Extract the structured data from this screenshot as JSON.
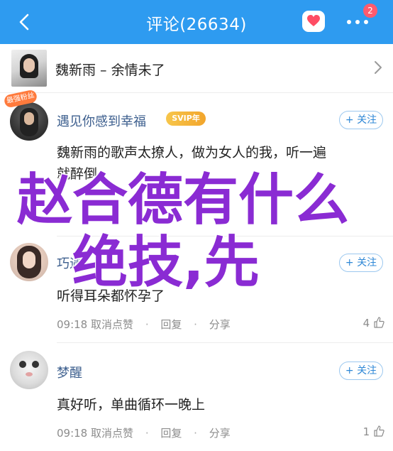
{
  "header": {
    "title": "评论(26634)",
    "badge_count": "2",
    "colors": {
      "bar": "#2e9bf0"
    },
    "icons": [
      "back-arrow-icon",
      "heart-icon",
      "more-icon"
    ]
  },
  "song": {
    "title": "魏新雨 – 余情未了"
  },
  "comments": [
    {
      "username": "遇见你感到幸福",
      "vip_label": "SVIP年",
      "hot_tag": "最强粉丝",
      "follow_label": "+ 关注",
      "text_line1": "魏新雨的歌声太撩人，做为女人的我，听一遍",
      "text_line2": "就醉倒"
    },
    {
      "username": "巧遇",
      "follow_label": "+ 关注",
      "text": "听得耳朵都怀孕了",
      "time": "09:18",
      "unlike": "取消点赞",
      "reply": "回复",
      "share": "分享",
      "likes": "4"
    },
    {
      "username": "梦醒",
      "follow_label": "+ 关注",
      "text": "真好听，单曲循环一晚上",
      "time": "09:18",
      "unlike": "取消点赞",
      "reply": "回复",
      "share": "分享",
      "likes": "1"
    }
  ],
  "overlay": {
    "line1": "赵合德有什么",
    "line2": "绝技,先",
    "color": "#8a2bd3"
  }
}
